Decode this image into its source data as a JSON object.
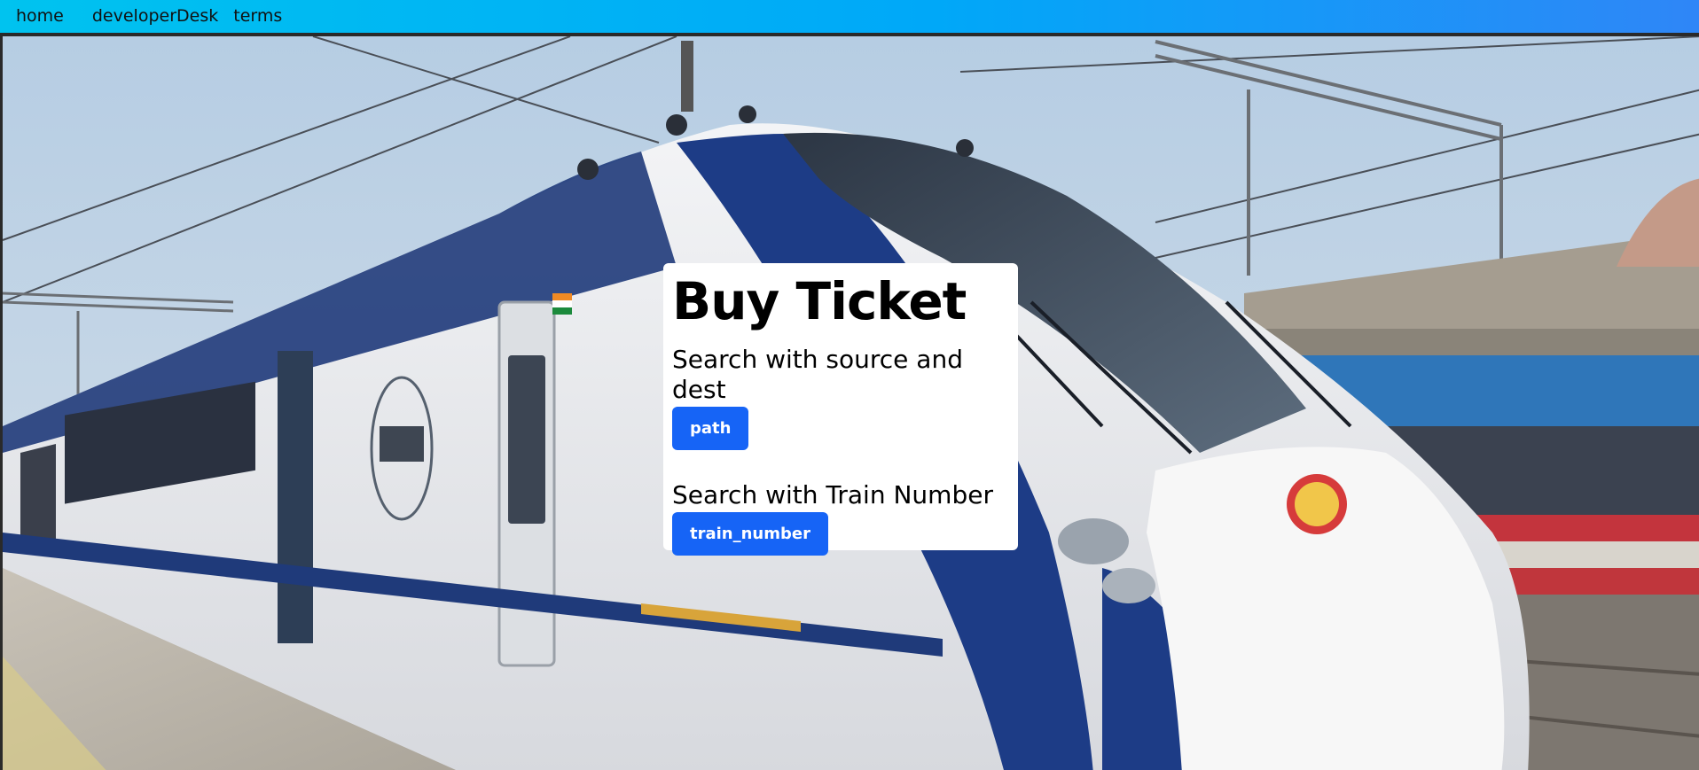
{
  "nav": {
    "links": [
      "home",
      "developerDesk",
      "terms"
    ]
  },
  "card": {
    "title": "Buy Ticket",
    "search_path_label": "Search with source and dest",
    "path_button": "path",
    "search_train_label": "Search with Train Number",
    "train_number_button": "train_number"
  },
  "colors": {
    "nav_gradient_start": "#00c3ef",
    "nav_gradient_end": "#2f86f7",
    "button": "#1664f6"
  }
}
